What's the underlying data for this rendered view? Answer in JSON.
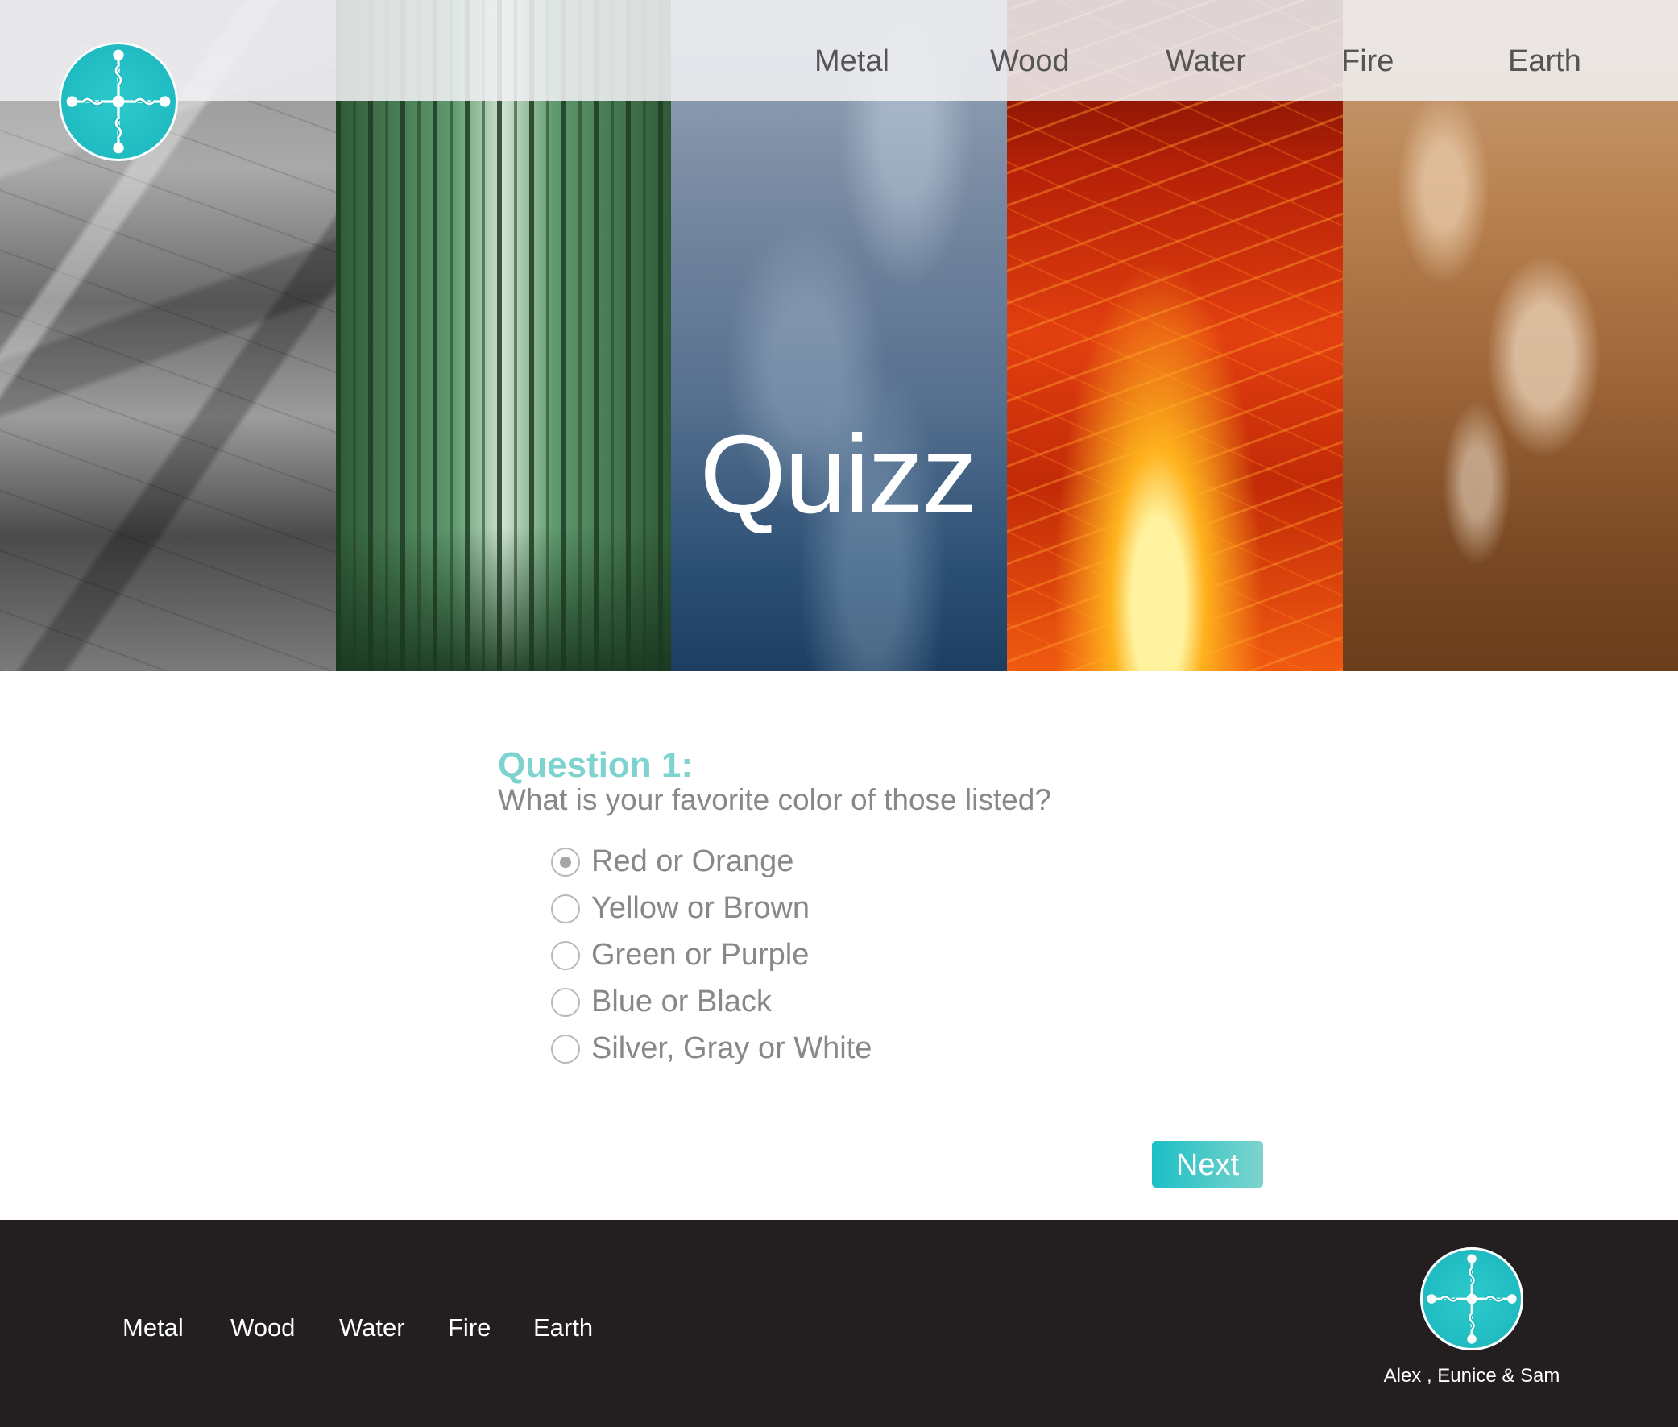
{
  "header": {
    "nav": [
      "Metal",
      "Wood",
      "Water",
      "Fire",
      "Earth"
    ]
  },
  "hero": {
    "title": "Quizz"
  },
  "quiz": {
    "question_label": "Question 1:",
    "question_text": "What is your favorite color of those listed?",
    "options": [
      {
        "label": "Red or Orange",
        "selected": true
      },
      {
        "label": "Yellow or Brown",
        "selected": false
      },
      {
        "label": "Green or Purple",
        "selected": false
      },
      {
        "label": "Blue or Black",
        "selected": false
      },
      {
        "label": "Silver, Gray or White",
        "selected": false
      }
    ],
    "next_label": "Next"
  },
  "footer": {
    "nav": [
      "Metal",
      "Wood",
      "Water",
      "Fire",
      "Earth"
    ],
    "credits": "Alex , Eunice & Sam"
  },
  "colors": {
    "accent": "#19b5bc",
    "question_label": "#7fd3cf",
    "footer_bg": "#231f20"
  }
}
